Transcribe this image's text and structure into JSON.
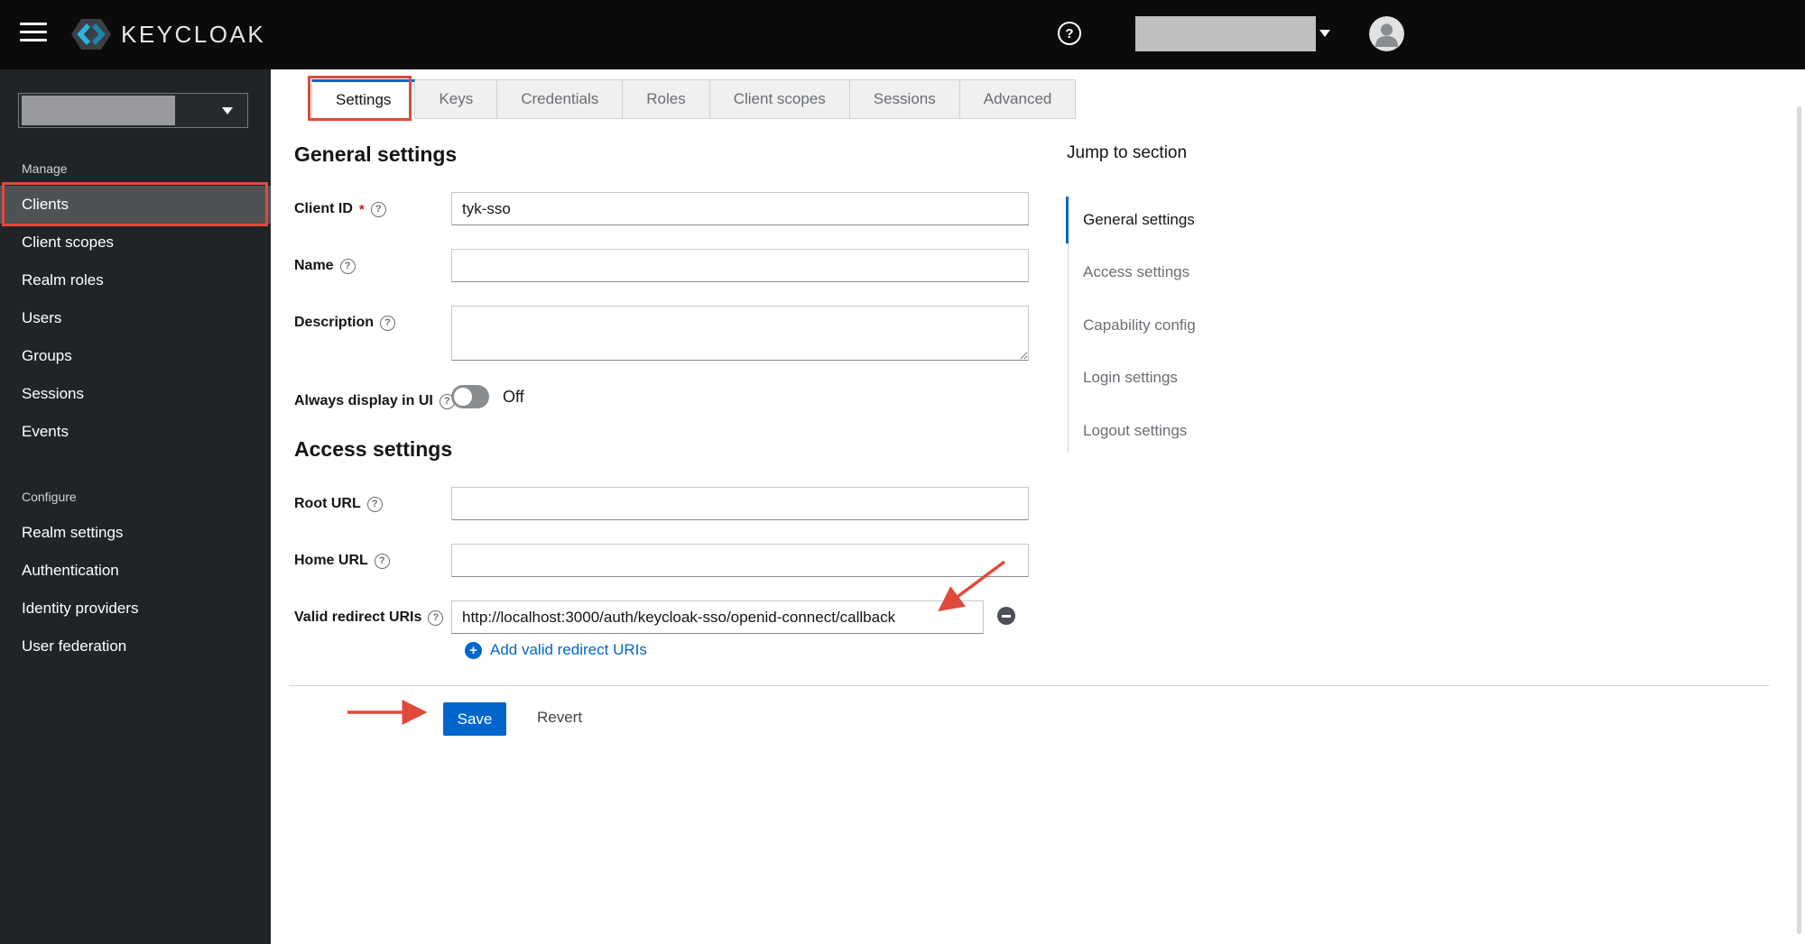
{
  "header": {
    "brand": "KEYCLOAK"
  },
  "icons": {
    "question": "?",
    "plus": "+"
  },
  "sidebar": {
    "manage_label": "Manage",
    "manage_items": [
      "Clients",
      "Client scopes",
      "Realm roles",
      "Users",
      "Groups",
      "Sessions",
      "Events"
    ],
    "configure_label": "Configure",
    "configure_items": [
      "Realm settings",
      "Authentication",
      "Identity providers",
      "User federation"
    ],
    "active_item": "Clients"
  },
  "tabs": {
    "items": [
      "Settings",
      "Keys",
      "Credentials",
      "Roles",
      "Client scopes",
      "Sessions",
      "Advanced"
    ],
    "active": "Settings"
  },
  "form": {
    "general_heading": "General settings",
    "access_heading": "Access settings",
    "client_id_label": "Client ID",
    "required_marker": "*",
    "client_id_value": "tyk-sso",
    "name_label": "Name",
    "name_value": "",
    "description_label": "Description",
    "description_value": "",
    "always_display_label": "Always display in UI",
    "always_display_state": "Off",
    "root_url_label": "Root URL",
    "root_url_value": "",
    "home_url_label": "Home URL",
    "home_url_value": "",
    "redirect_label": "Valid redirect URIs",
    "redirect_value": "http://localhost:3000/auth/keycloak-sso/openid-connect/callback",
    "add_redirect_label": "Add valid redirect URIs"
  },
  "jump": {
    "heading": "Jump to section",
    "items": [
      "General settings",
      "Access settings",
      "Capability config",
      "Login settings",
      "Logout settings"
    ],
    "active": "General settings"
  },
  "actions": {
    "save_label": "Save",
    "revert_label": "Revert"
  },
  "colors": {
    "accent_blue": "#0066cc",
    "annotation_red": "#e04a3a",
    "header_bg": "#0b0b0b",
    "sidebar_bg": "#212427",
    "sidebar_active_bg": "#4f5255",
    "save_button_bg": "#0066cc"
  }
}
